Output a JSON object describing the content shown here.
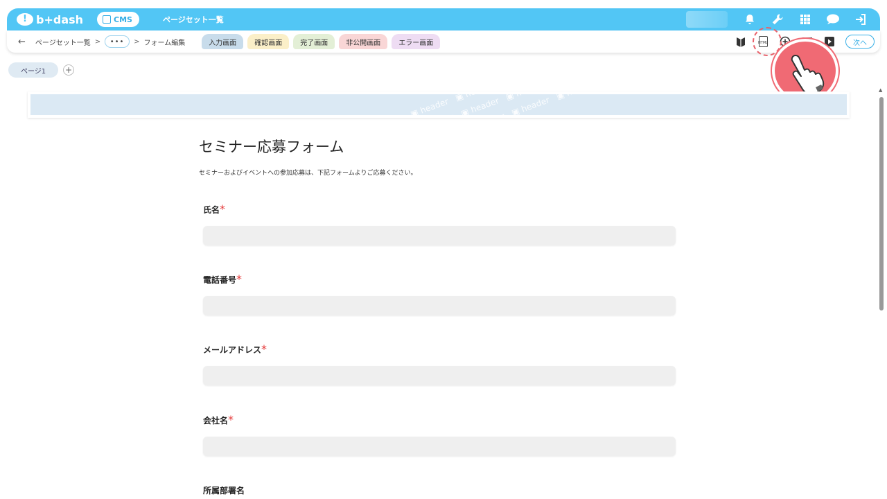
{
  "app": {
    "logo_text": "b+dash",
    "cms_label": "CMS",
    "title": "ページセット一覧"
  },
  "subbar": {
    "back_label": "←",
    "breadcrumb_root": "ページセット一覧",
    "sep": ">",
    "more": "•••",
    "breadcrumb_current": "フォーム編集",
    "tabs": [
      {
        "label": "入力画面",
        "color": "#c8dceb"
      },
      {
        "label": "確認画面",
        "color": "#fbefc8"
      },
      {
        "label": "完了画面",
        "color": "#e3efd6"
      },
      {
        "label": "非公開画面",
        "color": "#f9d6d6"
      },
      {
        "label": "エラー画面",
        "color": "#eedcf3"
      }
    ],
    "next_label": "次へ"
  },
  "pages": {
    "tab_label": "ページ1",
    "add": "+"
  },
  "header_block": {
    "pattern_text": "header"
  },
  "form": {
    "title": "セミナー応募フォーム",
    "description": "セミナーおよびイベントへの参加応募は、下記フォームよりご応募ください。",
    "fields": [
      {
        "label": "氏名",
        "required_mark": "*"
      },
      {
        "label": "電話番号",
        "required_mark": "*"
      },
      {
        "label": "メールアドレス",
        "required_mark": "*"
      },
      {
        "label": "会社名",
        "required_mark": "*"
      },
      {
        "label": "所属部署名",
        "required_mark": ""
      }
    ]
  },
  "colors": {
    "brand": "#52c6f5",
    "accent_pointer": "#f06a74"
  },
  "icons": [
    "bell-icon",
    "wrench-icon",
    "grid-icon",
    "chat-icon",
    "logout-icon",
    "guide-icon",
    "html-icon",
    "plus-circle-icon",
    "menu-icon",
    "play-icon"
  ]
}
